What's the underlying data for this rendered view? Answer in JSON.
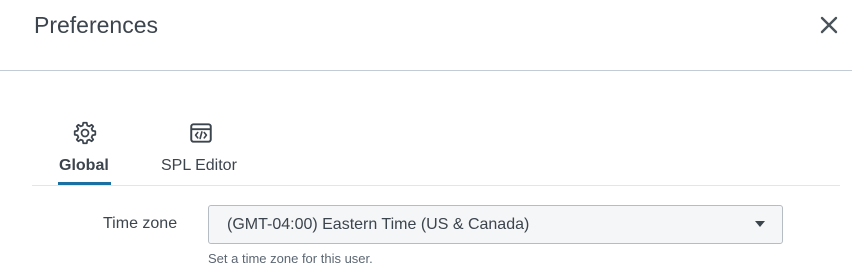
{
  "dialog": {
    "title": "Preferences"
  },
  "tabs": [
    {
      "label": "Global",
      "icon": "gear-icon",
      "active": true
    },
    {
      "label": "SPL Editor",
      "icon": "code-editor-icon",
      "active": false
    }
  ],
  "form": {
    "timezone": {
      "label": "Time zone",
      "value": "(GMT-04:00) Eastern Time (US & Canada)",
      "help": "Set a time zone for this user."
    }
  },
  "colors": {
    "accent": "#1a6fa3",
    "text": "#3c444d",
    "divider": "#c3cbd4"
  }
}
